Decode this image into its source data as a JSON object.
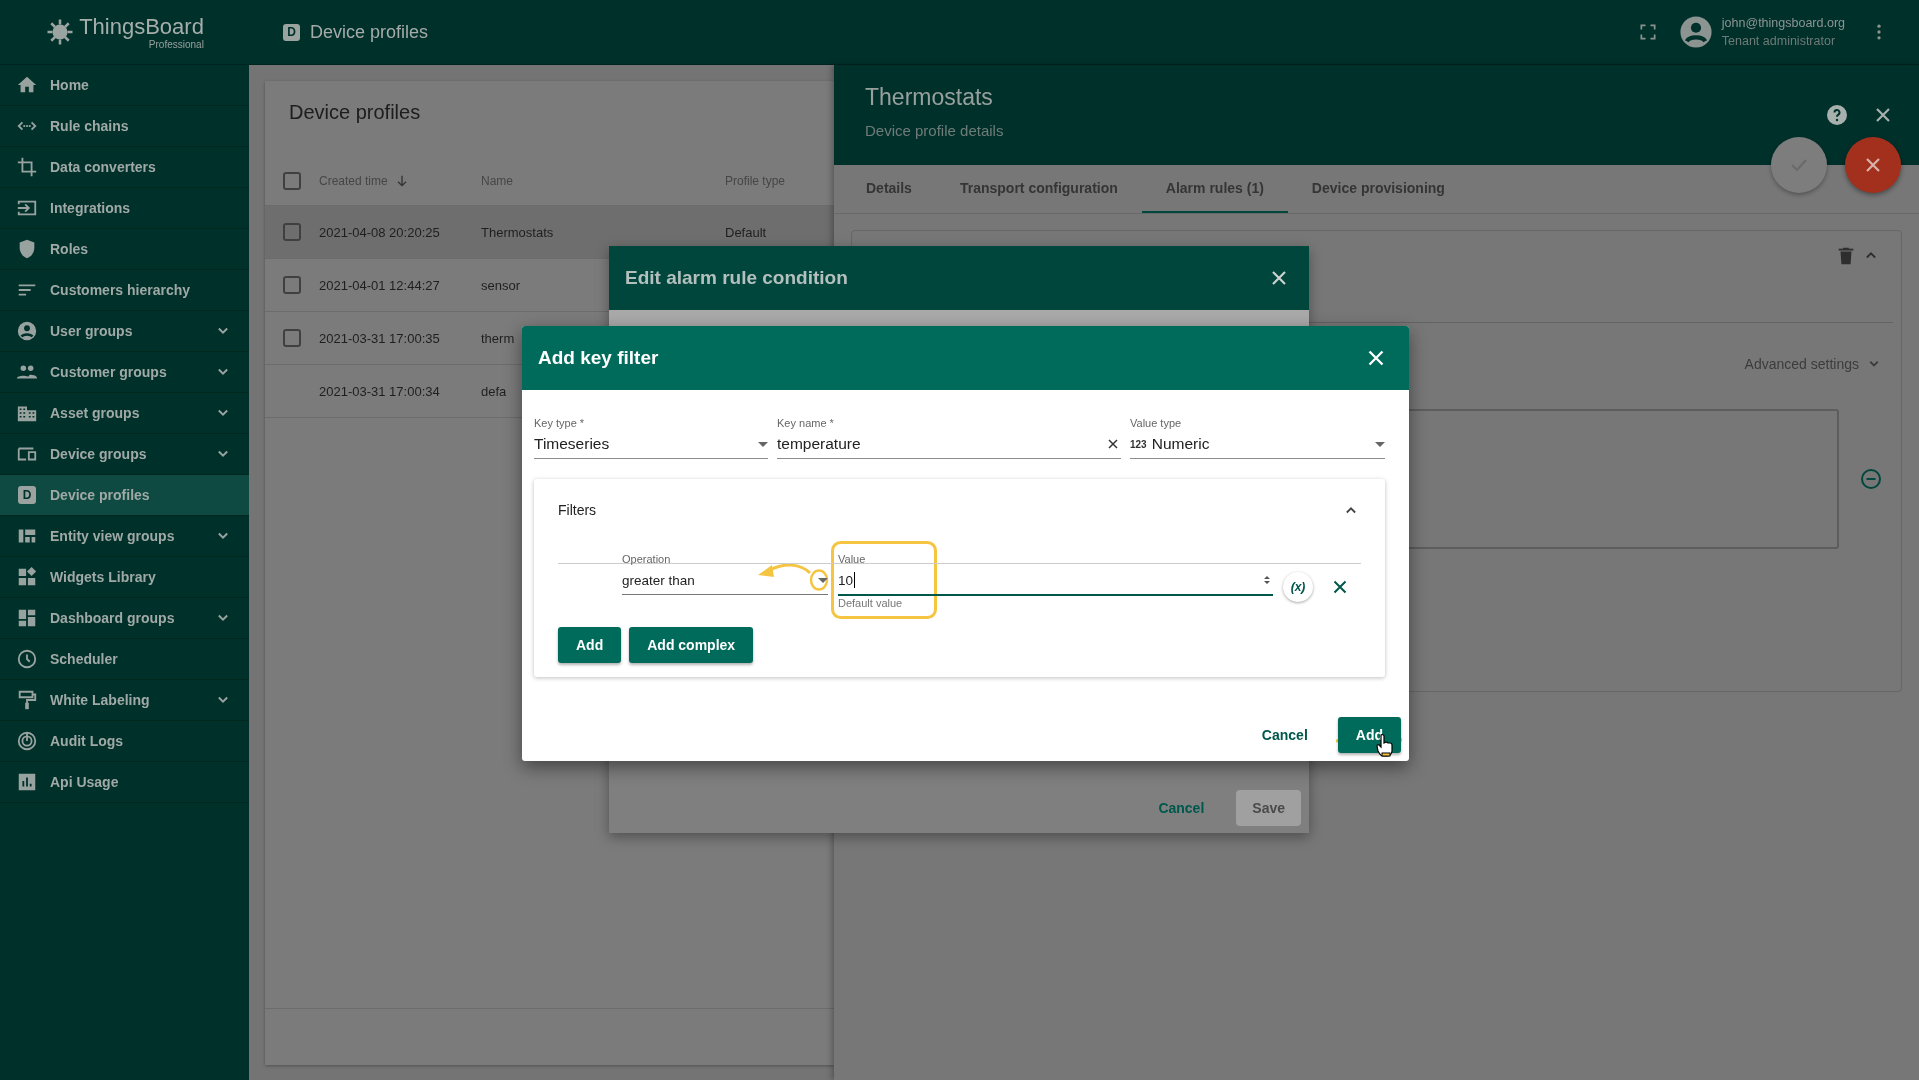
{
  "header": {
    "logo_name": "ThingsBoard",
    "logo_tagline": "Professional",
    "page_badge": "D",
    "page_title": "Device profiles",
    "user_email": "john@thingsboard.org",
    "user_role": "Tenant administrator"
  },
  "sidebar": {
    "items": [
      {
        "label": "Home",
        "expandable": false,
        "selected": false
      },
      {
        "label": "Rule chains",
        "expandable": false,
        "selected": false
      },
      {
        "label": "Data converters",
        "expandable": false,
        "selected": false
      },
      {
        "label": "Integrations",
        "expandable": false,
        "selected": false
      },
      {
        "label": "Roles",
        "expandable": false,
        "selected": false
      },
      {
        "label": "Customers hierarchy",
        "expandable": false,
        "selected": false
      },
      {
        "label": "User groups",
        "expandable": true,
        "selected": false
      },
      {
        "label": "Customer groups",
        "expandable": true,
        "selected": false
      },
      {
        "label": "Asset groups",
        "expandable": true,
        "selected": false
      },
      {
        "label": "Device groups",
        "expandable": true,
        "selected": false
      },
      {
        "label": "Device profiles",
        "expandable": false,
        "selected": true,
        "badge": "D"
      },
      {
        "label": "Entity view groups",
        "expandable": true,
        "selected": false
      },
      {
        "label": "Widgets Library",
        "expandable": false,
        "selected": false
      },
      {
        "label": "Dashboard groups",
        "expandable": true,
        "selected": false
      },
      {
        "label": "Scheduler",
        "expandable": false,
        "selected": false
      },
      {
        "label": "White Labeling",
        "expandable": true,
        "selected": false
      },
      {
        "label": "Audit Logs",
        "expandable": false,
        "selected": false
      },
      {
        "label": "Api Usage",
        "expandable": false,
        "selected": false
      }
    ]
  },
  "list": {
    "title": "Device profiles",
    "header_checked": false,
    "columns": [
      "Created time",
      "Name",
      "Profile type"
    ],
    "rows": [
      {
        "created": "2021-04-08 20:20:25",
        "name": "Thermostats",
        "profile_type": "Default",
        "selectable": true,
        "checked": false,
        "selected": true
      },
      {
        "created": "2021-04-01 12:44:27",
        "name": "sensor",
        "selectable": true,
        "checked": false,
        "selected": false
      },
      {
        "created": "2021-03-31 17:00:35",
        "name": "therm",
        "selectable": true,
        "checked": false,
        "selected": false
      },
      {
        "created": "2021-03-31 17:00:34",
        "name": "defa",
        "selectable": false,
        "selected": false
      }
    ]
  },
  "details": {
    "title": "Thermostats",
    "subtitle": "Device profile details",
    "tabs": [
      {
        "label": "Details",
        "selected": false
      },
      {
        "label": "Transport configuration",
        "selected": false
      },
      {
        "label": "Alarm rules (1)",
        "selected": true
      },
      {
        "label": "Device provisioning",
        "selected": false
      }
    ],
    "advanced_settings": "Advanced settings"
  },
  "edit_dialog": {
    "title": "Edit alarm rule condition",
    "buttons": [
      {
        "label": "Cancel",
        "kind": "text",
        "disabled": false
      },
      {
        "label": "Save",
        "kind": "raised",
        "disabled": true
      }
    ]
  },
  "key_filter_dialog": {
    "title": "Add key filter",
    "fields": [
      {
        "label": "Key type *",
        "value": "Timeseries",
        "kind": "select"
      },
      {
        "label": "Key name *",
        "value": "temperature",
        "kind": "clearable"
      },
      {
        "label": "Value type",
        "value": "Numeric",
        "kind": "select",
        "badge": "123"
      }
    ],
    "filters": {
      "title": "Filters",
      "expanded": true,
      "operation_label": "Operation",
      "operation": "greater than",
      "value_label": "Value",
      "value": "10",
      "value_hint": "Default value",
      "dynamic_toggle": "(x)",
      "buttons": [
        "Add",
        "Add complex"
      ]
    },
    "buttons": [
      {
        "label": "Cancel",
        "kind": "text"
      },
      {
        "label": "Add",
        "kind": "raised"
      }
    ]
  }
}
